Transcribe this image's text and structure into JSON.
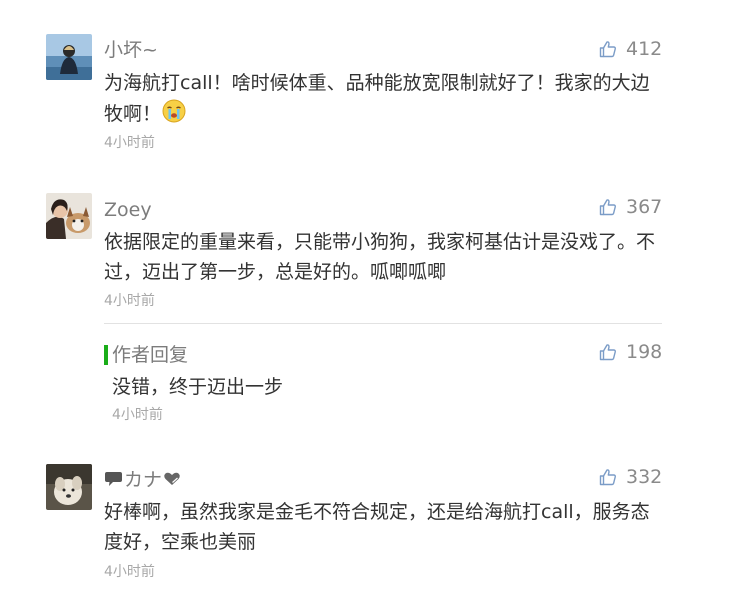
{
  "comments": [
    {
      "nickname": "小坏~",
      "content": "为海航打call！啥时候体重、品种能放宽限制就好了！我家的大边牧啊！",
      "emoji": "crying-emoji",
      "time": "4小时前",
      "likes": "412"
    },
    {
      "nickname": "Zoey",
      "content": "依据限定的重量来看，只能带小狗狗，我家柯基估计是没戏了。不过，迈出了第一步，总是好的。呱唧呱唧",
      "time": "4小时前",
      "likes": "367"
    },
    {
      "nickname": "カナ",
      "content": "好棒啊，虽然我家是金毛不符合规定，还是给海航打call，服务态度好，空乘也美丽",
      "time": "4小时前",
      "likes": "332"
    }
  ],
  "author_reply": {
    "label": "作者回复",
    "content": "没错，终于迈出一步",
    "time": "4小时前",
    "likes": "198"
  },
  "colors": {
    "accent": "#1aad19",
    "text": "#333333",
    "meta": "#a8a8a8",
    "nickname": "#7c7c7c"
  },
  "icons": [
    "thumbs-up-icon",
    "crying-emoji",
    "speech-bubble-icon",
    "heart-icon"
  ]
}
